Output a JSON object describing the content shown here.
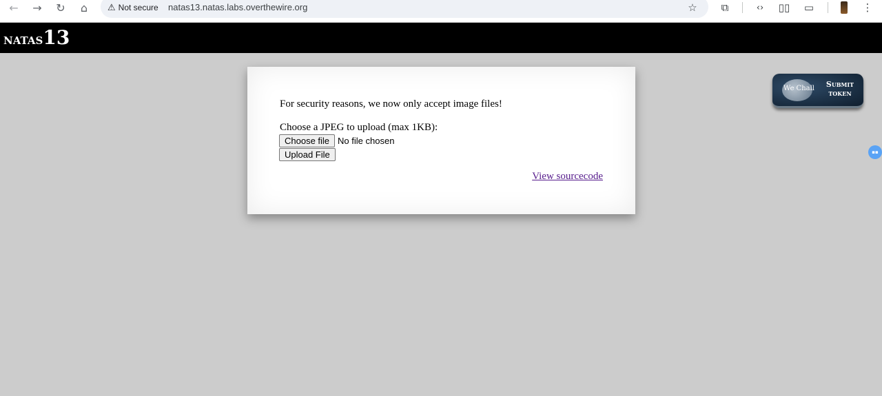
{
  "browser": {
    "security_label": "Not secure",
    "url": "natas13.natas.labs.overthewire.org",
    "icons": {
      "back": "arrow-left-icon",
      "forward": "arrow-right-icon",
      "reload": "reload-icon",
      "home": "home-icon",
      "warning": "warning-icon",
      "bookmark": "star-icon",
      "extensions": "puzzle-icon",
      "devtools": "code-icon",
      "reader": "book-icon",
      "devices": "devices-icon",
      "menu": "kebab-menu-icon"
    }
  },
  "header": {
    "title_small": "natas",
    "title_num": "13"
  },
  "content": {
    "message": "For security reasons, we now only accept image files!",
    "prompt": "Choose a JPEG to upload (max 1KB):",
    "choose_file_label": "Choose file",
    "file_status": "No file chosen",
    "upload_label": "Upload File",
    "source_link": "View sourcecode"
  },
  "wechall": {
    "logo_text": "We Chall",
    "submit_line1": "Submit",
    "submit_line2": "token"
  },
  "colors": {
    "page_bg": "#cccccc",
    "header_bg": "#000000",
    "link_visited": "#551a8b"
  }
}
